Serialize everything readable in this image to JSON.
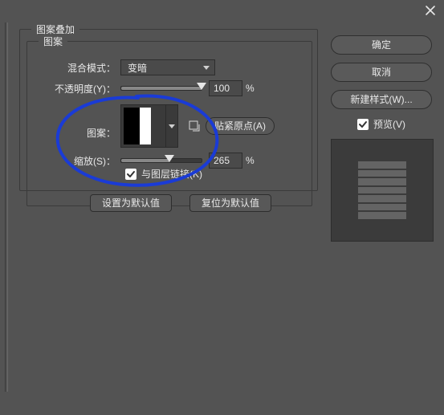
{
  "group_outer_title": "图案叠加",
  "group_inner_title": "图案",
  "buttons": {
    "ok": "确定",
    "cancel": "取消",
    "new_style": "新建样式(W)...",
    "preview": "预览(V)"
  },
  "labels": {
    "blend_mode": "混合模式：",
    "opacity": "不透明度(Y)：",
    "pattern": "图案：",
    "snap_origin": "贴紧原点(A)",
    "scale": "缩放(S)：",
    "link_layer": "与图层链接(K)",
    "set_default": "设置为默认值",
    "reset_default": "复位为默认值"
  },
  "values": {
    "blend_mode": "变暗",
    "opacity": "100",
    "scale": "265",
    "percent": "%"
  },
  "sliders": {
    "opacity_pct": 100,
    "scale_pct": 60
  },
  "checks": {
    "preview": true,
    "link_layer": true
  }
}
